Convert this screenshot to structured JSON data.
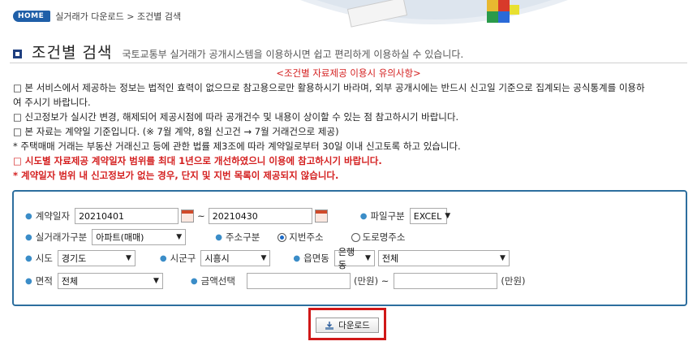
{
  "breadcrumb": {
    "home": "HOME",
    "path": "실거래가 다운로드 > 조건별 검색"
  },
  "header": {
    "title": "조건별 검색",
    "subtitle": "국토교통부 실거래가 공개시스템을 이용하시면 쉽고 편리하게 이용하실 수 있습니다."
  },
  "notice": {
    "heading": "<조건별 자료제공 이용시 유의사항>",
    "lines": [
      "□ 본 서비스에서 제공하는 정보는 법적인 효력이 없으므로 참고용으로만 활용하시기 바라며, 외부 공개시에는 반드시 신고일 기준으로 집계되는 공식통계를 이용하",
      "여 주시기 바랍니다.",
      "□ 신고정보가 실시간 변경, 해제되어 제공시점에 따라 공개건수 및 내용이 상이할 수 있는 점 참고하시기 바랍니다.",
      "□ 본 자료는 계약일 기준입니다. (※ 7월 계약, 8월 신고건 → 7월 거래건으로 제공)",
      "* 주택매매 거래는 부동산 거래신고 등에 관한 법률 제3조에 따라 계약일로부터 30일 이내 신고토록 하고 있습니다.",
      "□ 시도별 자료제공 계약일자 범위를 최대 1년으로 개선하였으니 이용에 참고하시기 바랍니다.",
      "* 계약일자 범위 내 신고정보가 없는 경우, 단지 및 지번 목록이 제공되지 않습니다."
    ]
  },
  "form": {
    "contract_date_label": "계약일자",
    "date_from": "20210401",
    "date_tilde": "~",
    "date_to": "20210430",
    "file_type_label": "파일구분",
    "file_type_value": "EXCEL",
    "trade_type_label": "실거래가구분",
    "trade_type_value": "아파트(매매)",
    "address_type_label": "주소구분",
    "address_option_jibun": "지번주소",
    "address_option_road": "도로명주소",
    "sido_label": "시도",
    "sido_value": "경기도",
    "sigungu_label": "시군구",
    "sigungu_value": "시흥시",
    "eupmyeondong_label": "읍면동",
    "eupmyeondong_value": "은행동",
    "danji_value": "전체",
    "area_label": "면적",
    "area_value": "전체",
    "amount_label": "금액선택",
    "amount_unit_from": "(만원) ~",
    "amount_unit_to": "(만원)"
  },
  "actions": {
    "download_label": "다운로드"
  },
  "colors": {
    "panel_border": "#2d6e9e",
    "notice_red": "#d42020",
    "highlight_frame": "#d01818"
  }
}
